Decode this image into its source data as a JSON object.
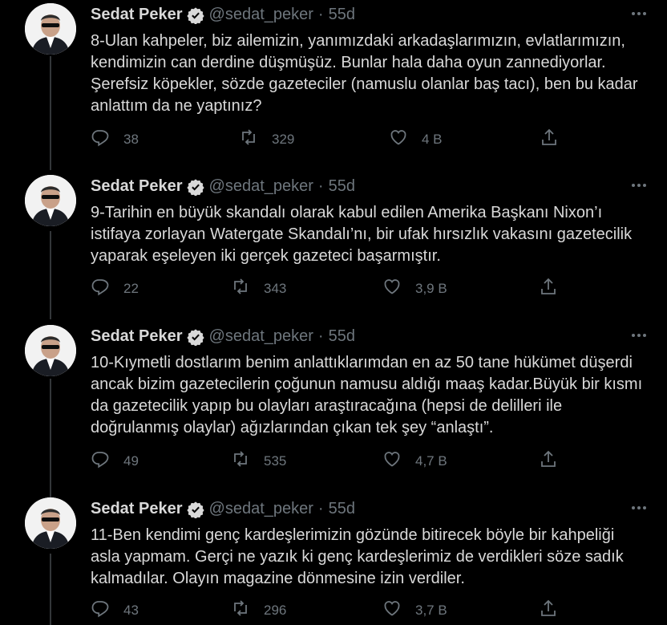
{
  "tweets": [
    {
      "name": "Sedat Peker",
      "handle": "@sedat_peker",
      "separator": "·",
      "time": "55d",
      "text": "8-Ulan kahpeler, biz ailemizin, yanımızdaki arkadaşlarımızın, evlatlarımızın, kendimizin can derdine düşmüşüz. Bunlar hala daha oyun zannediyorlar. Şerefsiz köpekler, sözde gazeteciler (namuslu olanlar baş tacı), ben bu kadar anlattım da ne yaptınız?",
      "replies": "38",
      "retweets": "329",
      "likes": "4 B"
    },
    {
      "name": "Sedat Peker",
      "handle": "@sedat_peker",
      "separator": "·",
      "time": "55d",
      "text": "9-Tarihin en büyük skandalı olarak kabul edilen Amerika Başkanı Nixon’ı istifaya zorlayan Watergate Skandalı’nı, bir ufak hırsızlık vakasını gazetecilik yaparak eşeleyen iki gerçek gazeteci başarmıştır.",
      "replies": "22",
      "retweets": "343",
      "likes": "3,9 B"
    },
    {
      "name": "Sedat Peker",
      "handle": "@sedat_peker",
      "separator": "·",
      "time": "55d",
      "text": "10-Kıymetli dostlarım benim anlattıklarımdan en az 50 tane hükümet düşerdi ancak bizim gazetecilerin çoğunun namusu aldığı maaş kadar.Büyük bir kısmı da gazetecilik yapıp bu olayları araştıracağına (hepsi de delilleri ile doğrulanmış olaylar) ağızlarından çıkan tek şey “anlaştı”.",
      "replies": "49",
      "retweets": "535",
      "likes": "4,7 B"
    },
    {
      "name": "Sedat Peker",
      "handle": "@sedat_peker",
      "separator": "·",
      "time": "55d",
      "text": "11-Ben kendimi genç kardeşlerimizin gözünde bitirecek böyle bir kahpeliği asla yapmam. Gerçi ne yazık ki genç kardeşlerimiz de verdikleri söze sadık kalmadılar. Olayın magazine dönmesine izin verdiler.",
      "replies": "43",
      "retweets": "296",
      "likes": "3,7 B"
    }
  ],
  "icons": {
    "verified": "verified-badge-icon",
    "more": "more-dots-icon",
    "reply": "reply-bubble-icon",
    "retweet": "retweet-icon",
    "like": "heart-icon",
    "share": "share-icon"
  },
  "colors": {
    "background": "#000000",
    "text": "#d9d9d9",
    "secondary": "#6e767d",
    "thread_line": "#333639"
  }
}
